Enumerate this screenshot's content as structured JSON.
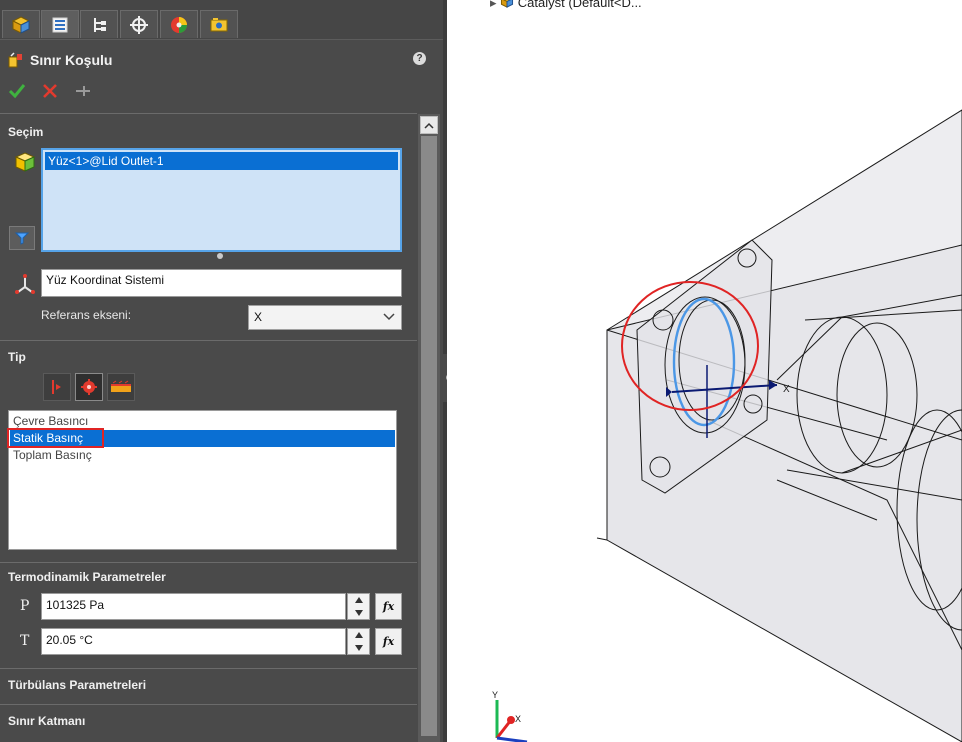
{
  "tabs": [
    {
      "icon": "feature-manager-icon"
    },
    {
      "icon": "property-manager-icon"
    },
    {
      "icon": "configuration-manager-icon"
    },
    {
      "icon": "dimxpert-icon"
    },
    {
      "icon": "display-manager-icon"
    },
    {
      "icon": "flow-simulation-icon"
    }
  ],
  "property_manager": {
    "title": "Sınır Koşulu",
    "help": "?"
  },
  "selection": {
    "title": "Seçim",
    "items": [
      "Yüz<1>@Lid Outlet-1"
    ],
    "coordinate_system": "Yüz Koordinat Sistemi",
    "reference_axis_label": "Referans ekseni:",
    "reference_axis_value": "X"
  },
  "tip": {
    "title": "Tip",
    "items": [
      "Çevre Basıncı",
      "Statik Basınç",
      "Toplam Basınç"
    ],
    "selected_index": 1
  },
  "thermo": {
    "title": "Termodinamik Parametreler",
    "pressure_symbol": "P",
    "pressure_value": "101325 Pa",
    "temperature_symbol": "T",
    "temperature_value": "20.05 °C",
    "fx": "fx"
  },
  "turbulence": {
    "title": "Türbülans Parametreleri"
  },
  "boundary_layer": {
    "title": "Sınır Katmanı"
  },
  "viewport": {
    "tree_item": "Catalyst  (Default<D..."
  },
  "colors": {
    "panel_bg": "#4a4a4a",
    "selection_blue": "#0a6fd3",
    "highlight_red": "#e02424",
    "face_blue": "#4b97e6"
  }
}
